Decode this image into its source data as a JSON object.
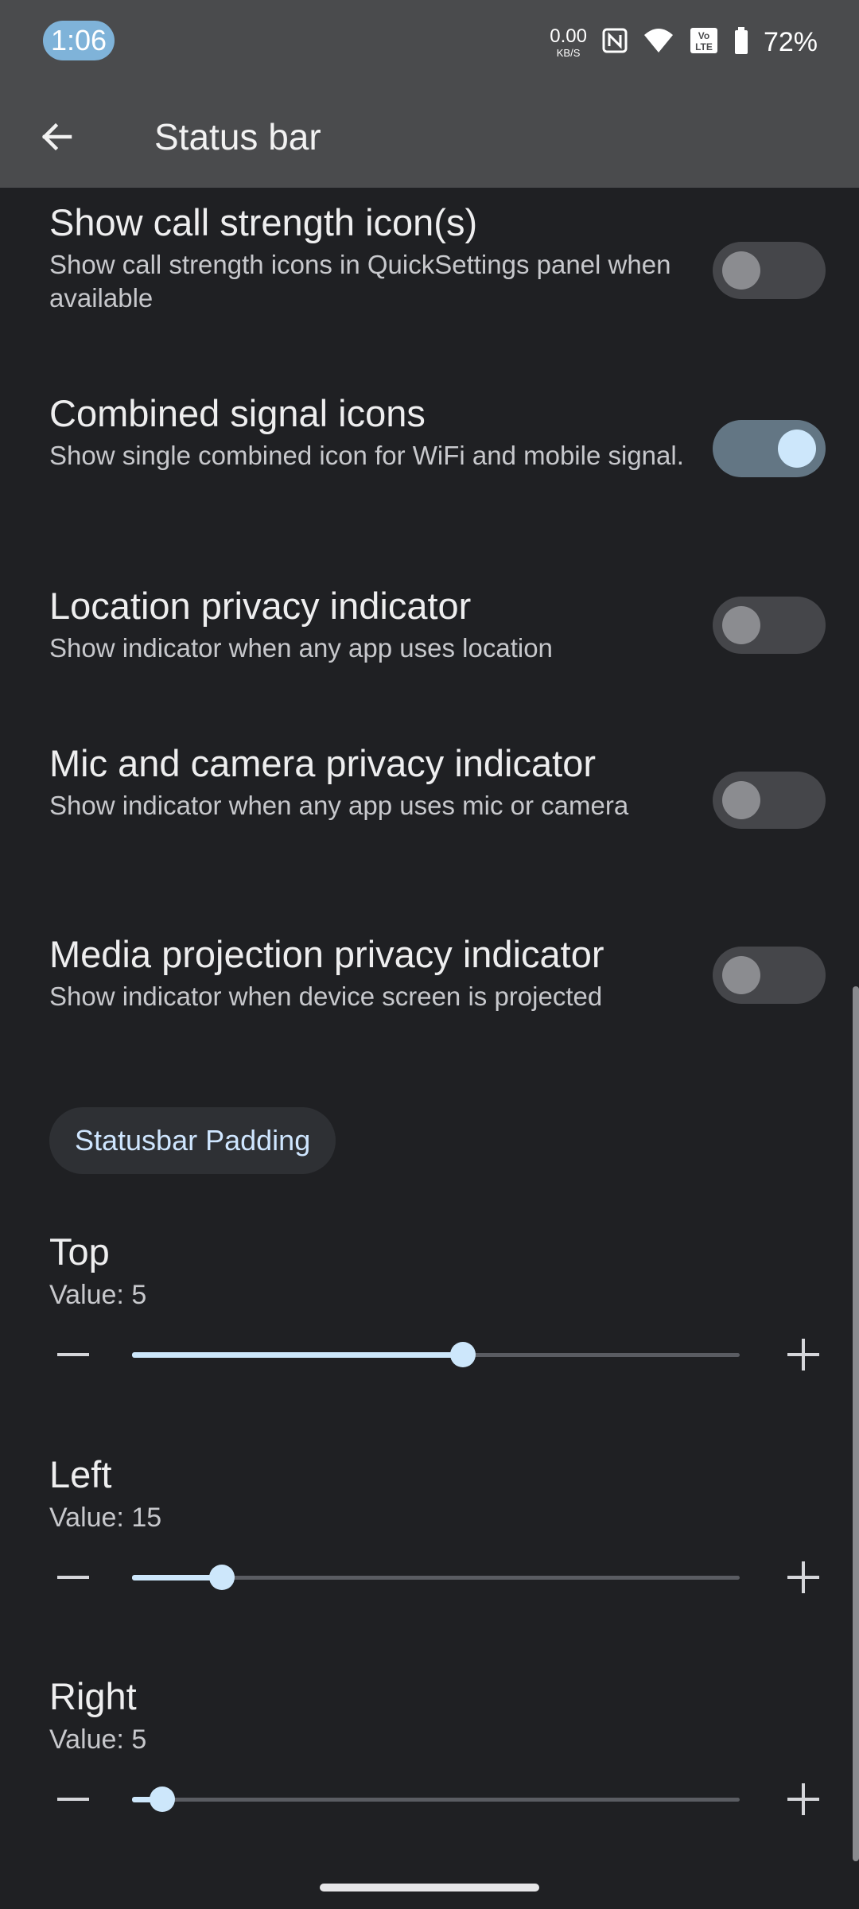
{
  "status_bar": {
    "time": "1:06",
    "net_speed_value": "0.00",
    "net_speed_unit": "KB/S",
    "battery_percent": "72%",
    "icons": [
      "nfc-icon",
      "wifi-icon",
      "volte-icon",
      "battery-icon"
    ]
  },
  "appbar": {
    "title": "Status bar",
    "back_icon": "arrow-back-icon"
  },
  "toggles": [
    {
      "title": "Show call strength icon(s)",
      "summary": "Show call strength icons in QuickSettings panel when available",
      "on": false
    },
    {
      "title": "Combined signal icons",
      "summary": "Show single combined icon for WiFi and mobile signal.",
      "on": true
    },
    {
      "title": "Location privacy indicator",
      "summary": "Show indicator when any app uses location",
      "on": false
    },
    {
      "title": "Mic and camera privacy indicator",
      "summary": "Show indicator when any app uses mic or camera",
      "on": false
    },
    {
      "title": "Media projection privacy indicator",
      "summary": "Show indicator when device screen is projected",
      "on": false
    }
  ],
  "section": {
    "label": "Statusbar Padding"
  },
  "sliders": [
    {
      "title": "Top",
      "value_text": "Value: 5",
      "fraction": 0.545
    },
    {
      "title": "Left",
      "value_text": "Value: 15",
      "fraction": 0.148
    },
    {
      "title": "Right",
      "value_text": "Value: 5",
      "fraction": 0.05
    }
  ],
  "colors": {
    "accent": "#cde7fb",
    "background": "#1f2023",
    "appbar": "#4a4b4d",
    "toggle_on_track": "#637684"
  }
}
